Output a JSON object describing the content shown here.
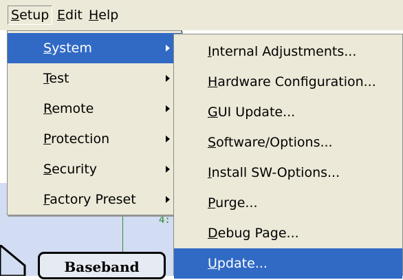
{
  "menubar": {
    "items": [
      {
        "label": "Setup",
        "mnemonic": "S",
        "rest": "etup"
      },
      {
        "label": "Edit",
        "mnemonic": "E",
        "rest": "dit"
      },
      {
        "label": "Help",
        "mnemonic": "H",
        "rest": "elp"
      }
    ]
  },
  "setup_menu": {
    "items": [
      {
        "label": "System",
        "mnemonic": "S",
        "rest": "ystem",
        "has_submenu": true,
        "highlighted": true
      },
      {
        "label": "Test",
        "mnemonic": "T",
        "rest": "est",
        "has_submenu": true
      },
      {
        "label": "Remote",
        "mnemonic": "R",
        "rest": "emote",
        "has_submenu": true
      },
      {
        "label": "Protection",
        "mnemonic": "P",
        "rest": "rotection",
        "has_submenu": true
      },
      {
        "label": "Security",
        "mnemonic": "S",
        "rest": "ecurity",
        "has_submenu": true
      },
      {
        "label": "Factory Preset",
        "mnemonic": "F",
        "rest": "actory Preset",
        "has_submenu": true
      }
    ]
  },
  "system_submenu": {
    "items": [
      {
        "label": "Internal Adjustments...",
        "mnemonic": "I",
        "rest": "nternal Adjustments..."
      },
      {
        "label": "Hardware Configuration...",
        "mnemonic": "H",
        "rest": "ardware Configuration..."
      },
      {
        "label": "GUI Update...",
        "mnemonic": "G",
        "rest": "UI Update..."
      },
      {
        "label": "Software/Options...",
        "mnemonic": "S",
        "rest": "oftware/Options..."
      },
      {
        "label": "Install SW-Options...",
        "mnemonic": "I",
        "rest": "nstall SW-Options..."
      },
      {
        "label": "Purge...",
        "mnemonic": "P",
        "rest": "urge..."
      },
      {
        "label": "Debug Page...",
        "mnemonic": "D",
        "rest": "ebug Page..."
      },
      {
        "label": "Update...",
        "mnemonic": "U",
        "rest": "pdate...",
        "highlighted": true
      }
    ]
  },
  "background": {
    "block_label": "Baseband",
    "connector_label": "4:"
  },
  "colors": {
    "menu_bg": "#ece9d8",
    "highlight_bg": "#316ac5",
    "highlight_text": "#ffffff",
    "diagram_panel": "#d2dcf2",
    "connector": "#2e8b2e"
  }
}
